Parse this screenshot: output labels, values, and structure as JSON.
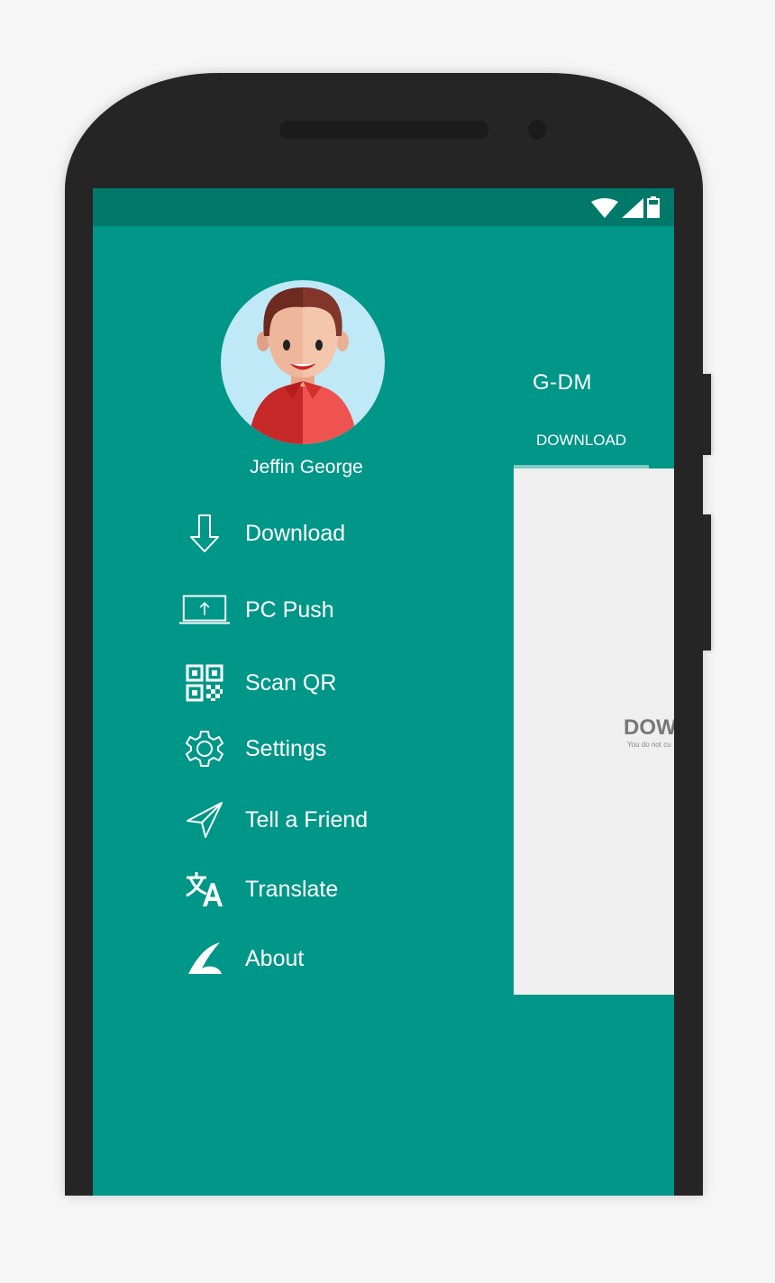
{
  "status_bar": {
    "icons": [
      "wifi-icon",
      "cell-signal-icon",
      "battery-icon"
    ]
  },
  "app": {
    "title": "G-DM",
    "tabs": [
      {
        "label": "DOWNLOAD",
        "active": true
      }
    ],
    "empty_state": {
      "title": "DOW",
      "subtitle": "You do not cu"
    }
  },
  "drawer": {
    "user": {
      "name": "Jeffin George",
      "avatar": "avatar-illustration"
    },
    "items": [
      {
        "label": "Download",
        "icon": "download-arrow-icon"
      },
      {
        "label": "PC Push",
        "icon": "laptop-upload-icon"
      },
      {
        "label": "Scan QR",
        "icon": "qr-code-icon"
      },
      {
        "label": "Settings",
        "icon": "gear-icon"
      },
      {
        "label": "Tell a Friend",
        "icon": "send-plane-icon"
      },
      {
        "label": "Translate",
        "icon": "translate-icon"
      },
      {
        "label": "About",
        "icon": "app-logo-icon"
      }
    ]
  },
  "colors": {
    "primary": "#009688",
    "primary_dark": "#00796b",
    "tab_indicator": "#80cbc4",
    "content_bg": "#efefef",
    "device_body": "#252525"
  }
}
